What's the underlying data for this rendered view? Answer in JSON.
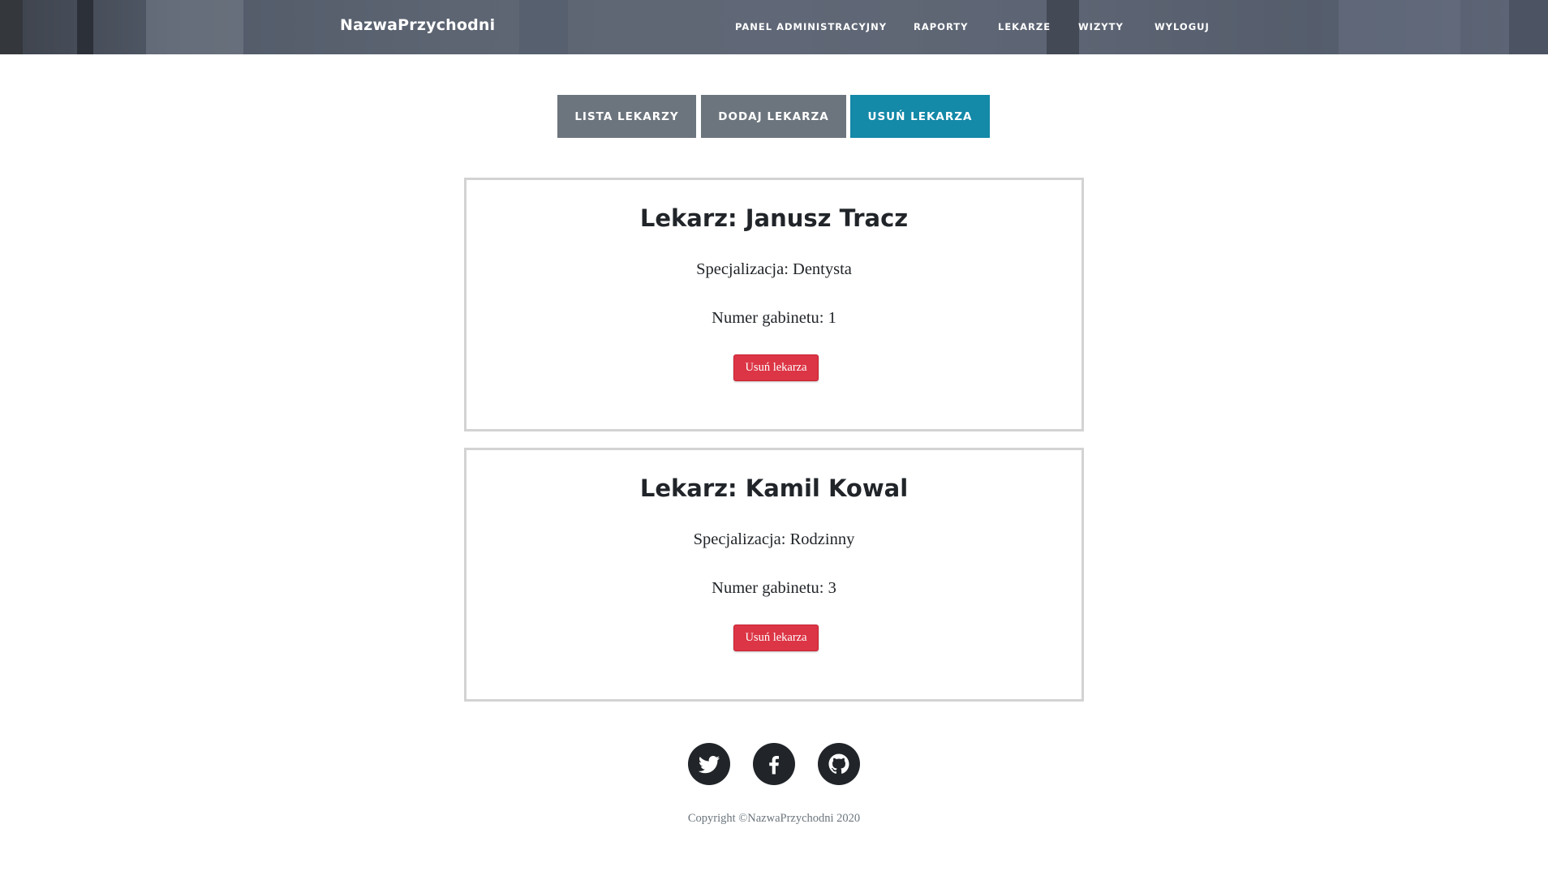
{
  "navbar": {
    "brand": "NazwaPrzychodni",
    "links": [
      "PANEL ADMINISTRACYJNY",
      "RAPORTY",
      "LEKARZE",
      "WIZYTY",
      "WYLOGUJ"
    ]
  },
  "tabs": [
    {
      "label": "LISTA LEKARZY",
      "color": "#6c757d"
    },
    {
      "label": "DODAJ LEKARZA",
      "color": "#6c757d"
    },
    {
      "label": "USUŃ LEKARZA",
      "color": "#1489a8",
      "active": true
    }
  ],
  "doctors": [
    {
      "title": "Lekarz: Janusz Tracz",
      "specialization_label": "Specjalizacja:",
      "specialization": "Dentysta",
      "room_label": "Numer gabinetu:",
      "room": "1",
      "delete_label": "Usuń lekarza"
    },
    {
      "title": "Lekarz: Kamil Kowal",
      "specialization_label": "Specjalizacja:",
      "specialization": "Rodzinny",
      "room_label": "Numer gabinetu:",
      "room": "3",
      "delete_label": "Usuń lekarza"
    }
  ],
  "footer": {
    "social": [
      "twitter-icon",
      "facebook-icon",
      "github-icon"
    ],
    "copyright": "Copyright ©NazwaPrzychodni 2020"
  },
  "colors": {
    "danger": "#dc3545",
    "info": "#1489a8",
    "secondary": "#6c757d",
    "dark": "#212529"
  }
}
